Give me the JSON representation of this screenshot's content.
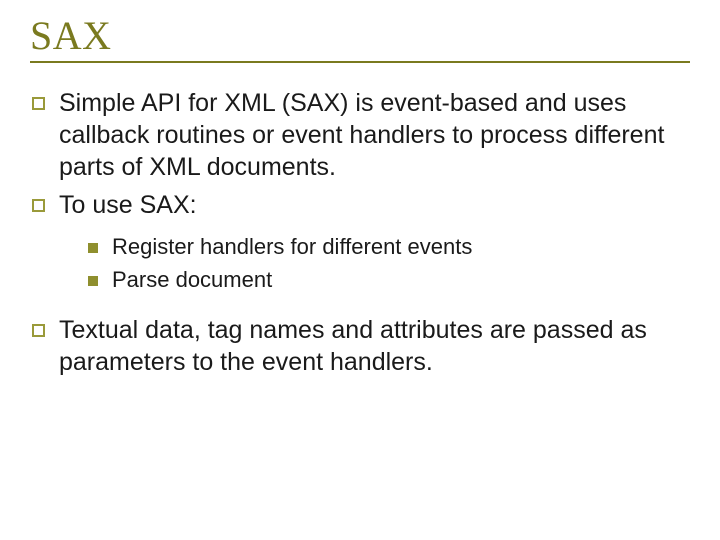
{
  "title": "SAX",
  "bullets": [
    {
      "level": 1,
      "text": "Simple API for XML (SAX) is event-based and uses callback routines or event handlers to process different parts of XML documents."
    },
    {
      "level": 1,
      "text": "To use SAX:"
    }
  ],
  "subbullets": [
    {
      "text": "Register handlers for different events"
    },
    {
      "text": "Parse document"
    }
  ],
  "bullets_after": [
    {
      "level": 1,
      "text": "Textual data, tag names and attributes are passed as parameters to the event handlers."
    }
  ]
}
